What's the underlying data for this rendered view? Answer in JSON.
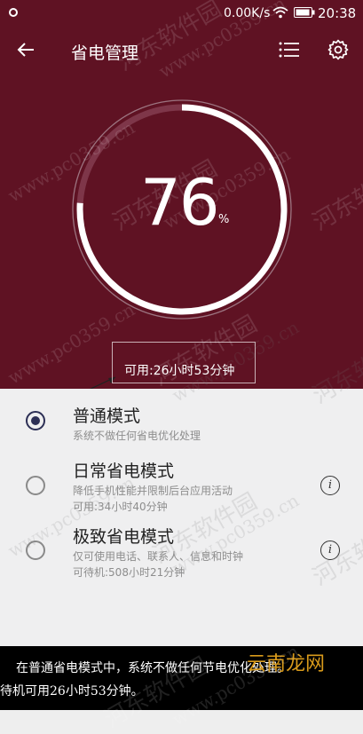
{
  "status_bar": {
    "speed": "0.00K/s",
    "time": "20:38"
  },
  "app_bar": {
    "title": "省电管理"
  },
  "battery": {
    "percent": "76",
    "percent_sign": "%",
    "level": 0.76,
    "available": "可用:26小时53分钟"
  },
  "modes": [
    {
      "title": "普通模式",
      "desc": [
        "系统不做任何省电优化处理"
      ],
      "selected": true
    },
    {
      "title": "日常省电模式",
      "desc": [
        "降低手机性能并限制后台应用活动",
        "可用:34小时40分钟"
      ],
      "selected": false
    },
    {
      "title": "极致省电模式",
      "desc": [
        "仅可使用电话、联系人、信息和时钟",
        "可待机:508小时21分钟"
      ],
      "selected": false
    }
  ],
  "info_glyph": "i",
  "caption": {
    "line1": "在普通省电模式中，系统不做任何节电优化处理。",
    "line2": "待机可用26小时53分钟。"
  },
  "watermark": {
    "text": "河东软件园",
    "url": "www.pc0359.cn",
    "logo": "云南龙网"
  },
  "colors": {
    "header_bg": "#5f1223",
    "accent_dark": "#2c2f55",
    "logo": "#d89a1b"
  }
}
